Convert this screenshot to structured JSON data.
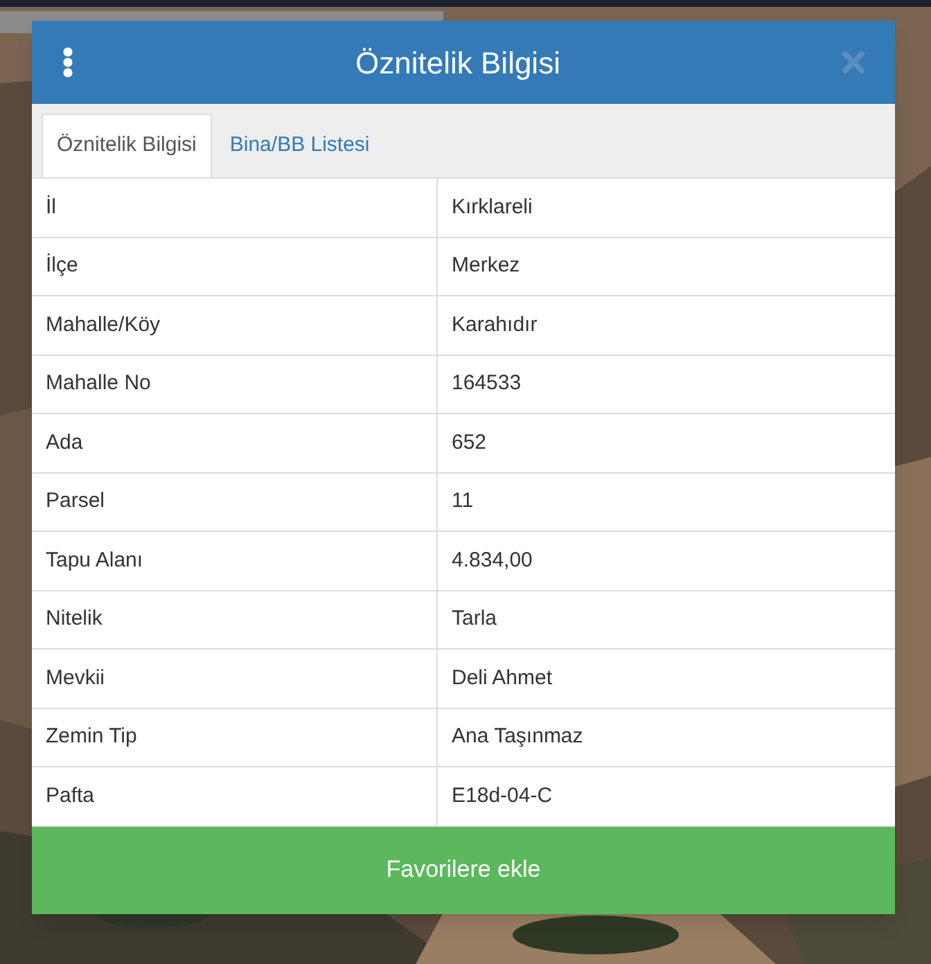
{
  "dialog": {
    "title": "Öznitelik Bilgisi"
  },
  "tabs": [
    {
      "label": "Öznitelik Bilgisi",
      "selected": true
    },
    {
      "label": "Bina/BB Listesi",
      "selected": false
    }
  ],
  "table": {
    "rows": [
      {
        "label": "İl",
        "value": "Kırklareli"
      },
      {
        "label": "İlçe",
        "value": "Merkez"
      },
      {
        "label": "Mahalle/Köy",
        "value": "Karahıdır"
      },
      {
        "label": "Mahalle No",
        "value": "164533"
      },
      {
        "label": "Ada",
        "value": "652"
      },
      {
        "label": "Parsel",
        "value": "11"
      },
      {
        "label": "Tapu Alanı",
        "value": "4.834,00"
      },
      {
        "label": "Nitelik",
        "value": "Tarla"
      },
      {
        "label": "Mevkii",
        "value": "Deli Ahmet"
      },
      {
        "label": "Zemin Tip",
        "value": "Ana Taşınmaz"
      },
      {
        "label": "Pafta",
        "value": "E18d-04-C"
      }
    ]
  },
  "button": {
    "label": "Favorilere ekle"
  }
}
